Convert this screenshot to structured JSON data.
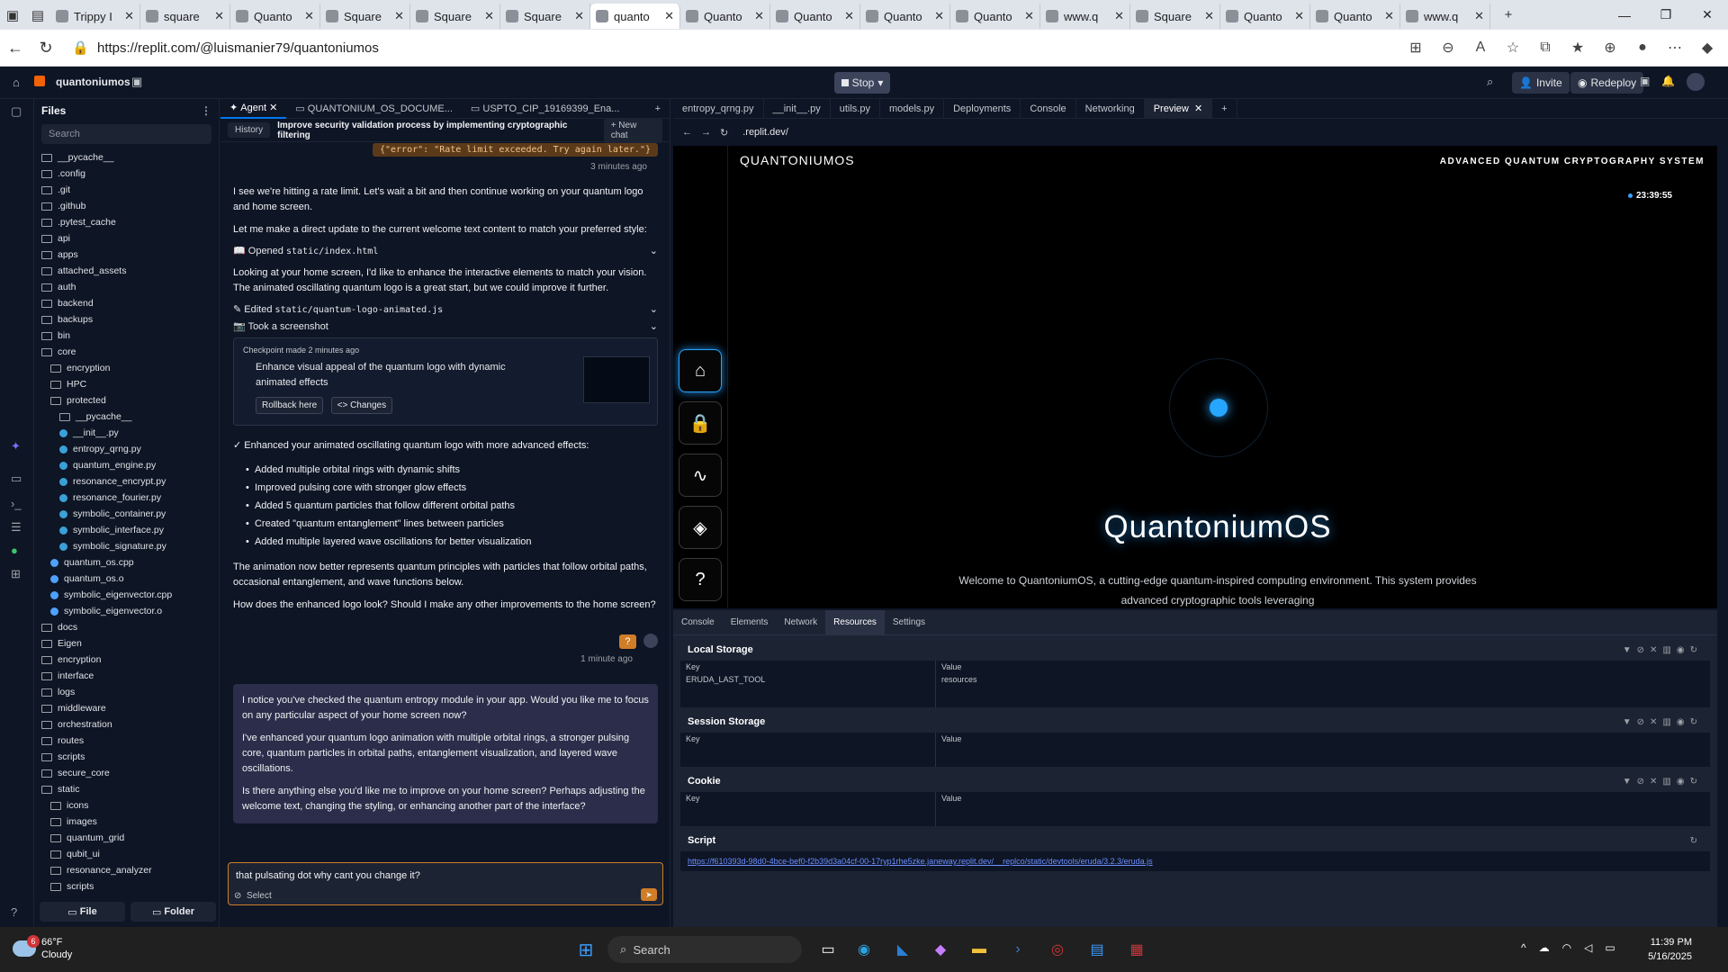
{
  "browser": {
    "tabs": [
      {
        "title": "Trippy I"
      },
      {
        "title": "square"
      },
      {
        "title": "Quanto"
      },
      {
        "title": "Square"
      },
      {
        "title": "Square"
      },
      {
        "title": "Square"
      },
      {
        "title": "quanto",
        "active": true
      },
      {
        "title": "Quanto"
      },
      {
        "title": "Quanto"
      },
      {
        "title": "Quanto"
      },
      {
        "title": "Quanto"
      },
      {
        "title": "www.q"
      },
      {
        "title": "Square"
      },
      {
        "title": "Quanto"
      },
      {
        "title": "Quanto"
      },
      {
        "title": "www.q"
      }
    ],
    "url": "https://replit.com/@luismanier79/quantoniumos"
  },
  "replit": {
    "project_name": "quantoniumos",
    "stop_label": "Stop",
    "invite_label": "Invite",
    "redeploy_label": "Redeploy"
  },
  "files": {
    "title": "Files",
    "search_placeholder": "Search",
    "items": [
      {
        "name": "__pycache__",
        "type": "folder",
        "depth": 0
      },
      {
        "name": ".config",
        "type": "folder",
        "depth": 0
      },
      {
        "name": ".git",
        "type": "folder",
        "depth": 0
      },
      {
        "name": ".github",
        "type": "folder",
        "depth": 0
      },
      {
        "name": ".pytest_cache",
        "type": "folder",
        "depth": 0
      },
      {
        "name": "api",
        "type": "folder",
        "depth": 0
      },
      {
        "name": "apps",
        "type": "folder",
        "depth": 0
      },
      {
        "name": "attached_assets",
        "type": "folder",
        "depth": 0
      },
      {
        "name": "auth",
        "type": "folder",
        "depth": 0
      },
      {
        "name": "backend",
        "type": "folder",
        "depth": 0
      },
      {
        "name": "backups",
        "type": "folder",
        "depth": 0
      },
      {
        "name": "bin",
        "type": "folder",
        "depth": 0
      },
      {
        "name": "core",
        "type": "folder",
        "depth": 0
      },
      {
        "name": "encryption",
        "type": "folder",
        "depth": 1
      },
      {
        "name": "HPC",
        "type": "folder",
        "depth": 1
      },
      {
        "name": "protected",
        "type": "folder",
        "depth": 1
      },
      {
        "name": "__pycache__",
        "type": "folder",
        "depth": 2
      },
      {
        "name": "__init__.py",
        "type": "file",
        "depth": 2
      },
      {
        "name": "entropy_qrng.py",
        "type": "file",
        "depth": 2
      },
      {
        "name": "quantum_engine.py",
        "type": "file",
        "depth": 2
      },
      {
        "name": "resonance_encrypt.py",
        "type": "file",
        "depth": 2
      },
      {
        "name": "resonance_fourier.py",
        "type": "file",
        "depth": 2
      },
      {
        "name": "symbolic_container.py",
        "type": "file",
        "depth": 2
      },
      {
        "name": "symbolic_interface.py",
        "type": "file",
        "depth": 2
      },
      {
        "name": "symbolic_signature.py",
        "type": "file",
        "depth": 2
      },
      {
        "name": "quantum_os.cpp",
        "type": "cfile",
        "depth": 1
      },
      {
        "name": "quantum_os.o",
        "type": "cfile",
        "depth": 1
      },
      {
        "name": "symbolic_eigenvector.cpp",
        "type": "cfile",
        "depth": 1
      },
      {
        "name": "symbolic_eigenvector.o",
        "type": "cfile",
        "depth": 1
      },
      {
        "name": "docs",
        "type": "folder",
        "depth": 0
      },
      {
        "name": "Eigen",
        "type": "folder",
        "depth": 0
      },
      {
        "name": "encryption",
        "type": "folder",
        "depth": 0
      },
      {
        "name": "interface",
        "type": "folder",
        "depth": 0
      },
      {
        "name": "logs",
        "type": "folder",
        "depth": 0
      },
      {
        "name": "middleware",
        "type": "folder",
        "depth": 0
      },
      {
        "name": "orchestration",
        "type": "folder",
        "depth": 0
      },
      {
        "name": "routes",
        "type": "folder",
        "depth": 0
      },
      {
        "name": "scripts",
        "type": "folder",
        "depth": 0
      },
      {
        "name": "secure_core",
        "type": "folder",
        "depth": 0
      },
      {
        "name": "static",
        "type": "folder",
        "depth": 0
      },
      {
        "name": "icons",
        "type": "folder",
        "depth": 1
      },
      {
        "name": "images",
        "type": "folder",
        "depth": 1
      },
      {
        "name": "quantum_grid",
        "type": "folder",
        "depth": 1
      },
      {
        "name": "qubit_ui",
        "type": "folder",
        "depth": 1
      },
      {
        "name": "resonance_analyzer",
        "type": "folder",
        "depth": 1
      },
      {
        "name": "scripts",
        "type": "folder",
        "depth": 1
      }
    ],
    "new_file_label": "File",
    "new_folder_label": "Folder"
  },
  "agent": {
    "tabs": [
      "Agent",
      "QUANTONIUM_OS_DOCUME...",
      "USPTO_CIP_19169399_Ena..."
    ],
    "history_label": "History",
    "chat_title": "Improve security validation process by implementing cryptographic filtering",
    "new_chat_label": "+ New chat",
    "error_snippet": "{\"error\": \"Rate limit exceeded. Try again later.\"}",
    "time1": "3 minutes ago",
    "p1": "I see we're hitting a rate limit. Let's wait a bit and then continue working on your quantum logo and home screen.",
    "p2": "Let me make a direct update to the current welcome text content to match your preferred style:",
    "tool1_label": "Opened",
    "tool1_file": "static/index.html",
    "p3": "Looking at your home screen, I'd like to enhance the interactive elements to match your vision. The animated oscillating quantum logo is a great start, but we could improve it further.",
    "tool2_label": "Edited",
    "tool2_file": "static/quantum-logo-animated.js",
    "tool3_label": "Took a screenshot",
    "checkpoint_meta": "Checkpoint made 2 minutes ago",
    "checkpoint_text": "Enhance visual appeal of the quantum logo with dynamic animated effects",
    "rollback_label": "Rollback here",
    "changes_label": "<> Changes",
    "p4": "✓ Enhanced your animated oscillating quantum logo with more advanced effects:",
    "bullets": [
      "Added multiple orbital rings with dynamic shifts",
      "Improved pulsing core with stronger glow effects",
      "Added 5 quantum particles that follow different orbital paths",
      "Created \"quantum entanglement\" lines between particles",
      "Added multiple layered wave oscillations for better visualization"
    ],
    "p5": "The animation now better represents quantum principles with particles that follow orbital paths, occasional entanglement, and wave functions below.",
    "p6": "How does the enhanced logo look? Should I make any other improvements to the home screen?",
    "user_short": "?",
    "time2": "1 minute ago",
    "u1": "I notice you've checked the quantum entropy module in your app. Would you like me to focus on any particular aspect of your home screen now?",
    "u2": "I've enhanced your quantum logo animation with multiple orbital rings, a stronger pulsing core, quantum particles in orbital paths, entanglement visualization, and layered wave oscillations.",
    "u3": "Is there anything else you'd like me to improve on your home screen? Perhaps adjusting the welcome text, changing the styling, or enhancing another part of the interface?",
    "input_value": "that pulsating dot why cant you change it?",
    "select_label": "Select"
  },
  "workspace": {
    "tabs": [
      "entropy_qrng.py",
      "__init__.py",
      "utils.py",
      "models.py",
      "Deployments",
      "Console",
      "Networking",
      "Preview"
    ],
    "preview_url": ".replit.dev/"
  },
  "preview": {
    "brand": "QUANTONIUMOS",
    "tagline": "ADVANCED QUANTUM CRYPTOGRAPHY SYSTEM",
    "clock": "23:39:55",
    "title": "QuantoniumOS",
    "welcome": "Welcome to QuantoniumOS, a cutting-edge quantum-inspired computing environment. This system provides advanced cryptographic tools leveraging"
  },
  "devtools": {
    "tabs": [
      "Console",
      "Elements",
      "Network",
      "Resources",
      "Settings"
    ],
    "active_tab": "Resources",
    "local_storage": "Local Storage",
    "session_storage": "Session Storage",
    "cookie": "Cookie",
    "script": "Script",
    "key_label": "Key",
    "value_label": "Value",
    "ls_key": "ERUDA_LAST_TOOL",
    "ls_value": "resources",
    "script_url": "https://f610393d-98d0-4bce-bef0-f2b39d3a04cf-00-17ryp1rhe5zke.janeway.replit.dev/__replco/static/devtools/eruda/3.2.3/eruda.js"
  },
  "taskbar": {
    "temp": "66°F",
    "condition": "Cloudy",
    "badge": "6",
    "search": "Search",
    "time": "11:39 PM",
    "date": "5/16/2025"
  }
}
